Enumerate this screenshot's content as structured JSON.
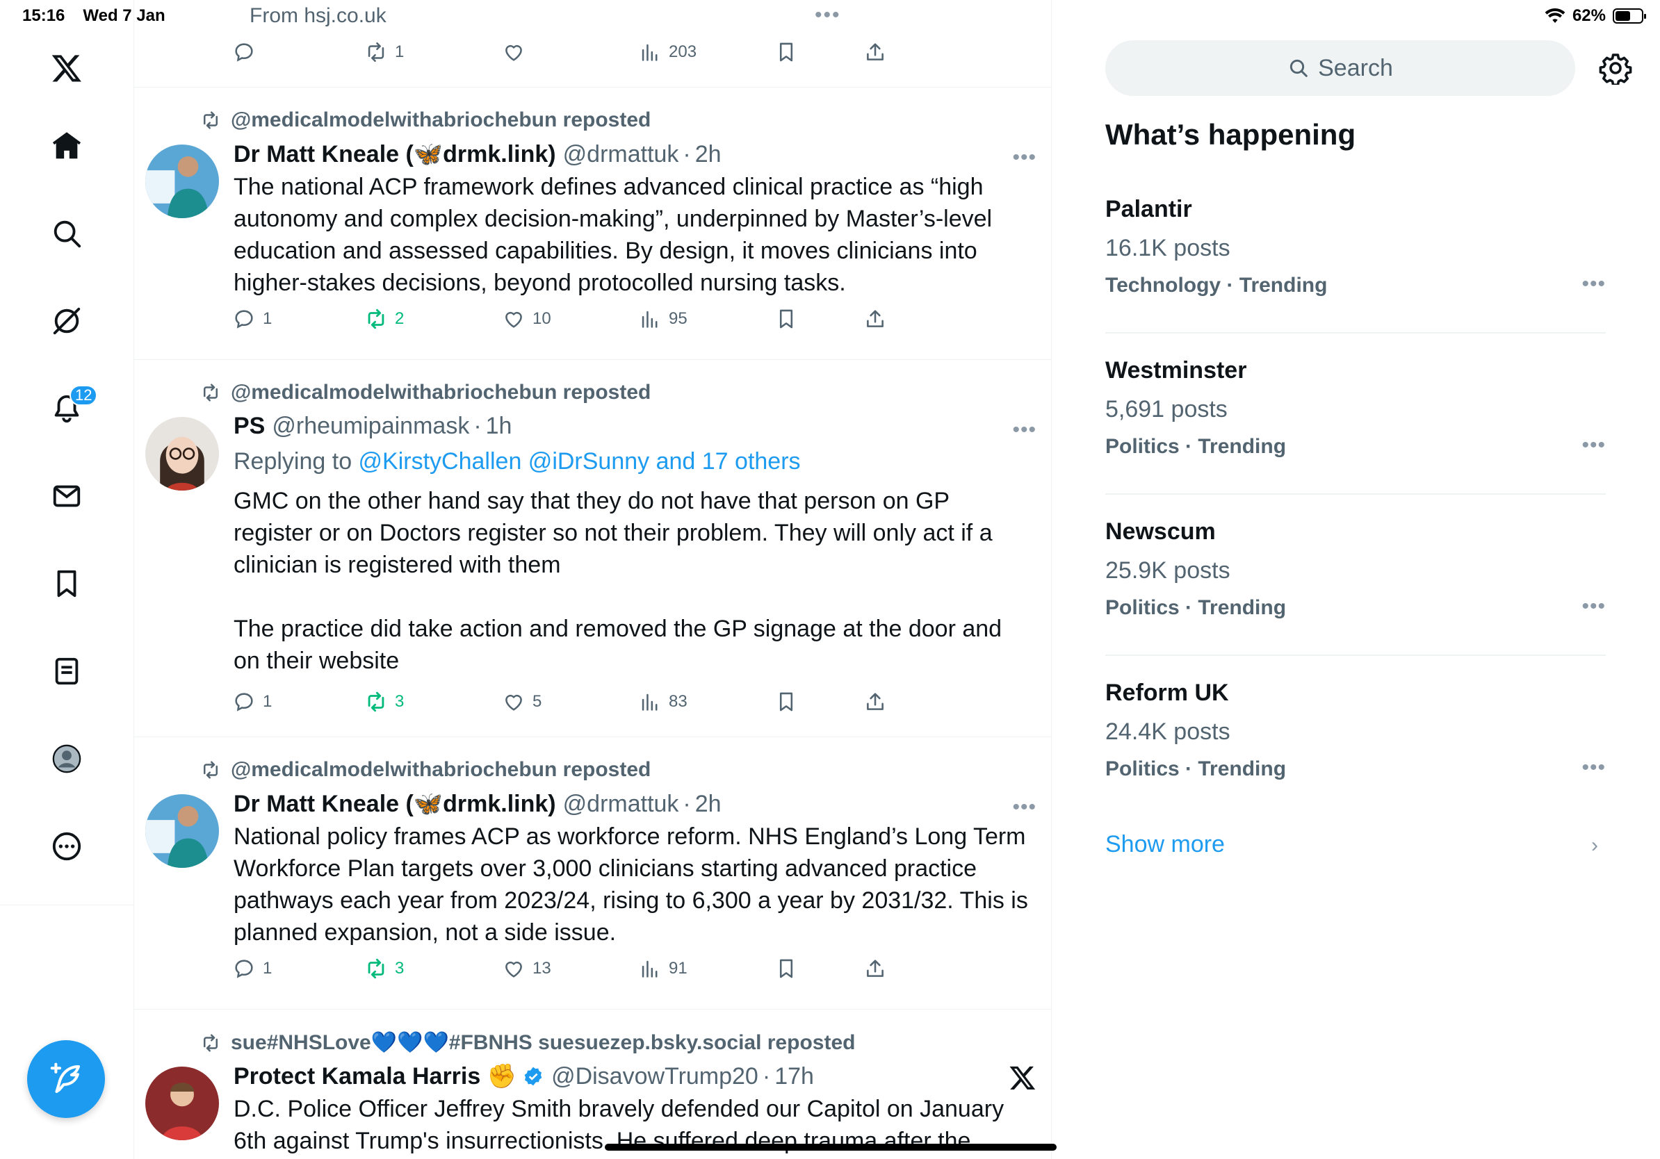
{
  "status_bar": {
    "time": "15:16",
    "date": "Wed 7 Jan",
    "battery": "62%",
    "battery_level": 0.62
  },
  "nav": {
    "items": [
      "x-logo",
      "home",
      "search",
      "grok",
      "notifications",
      "messages",
      "bookmarks",
      "lists",
      "profile",
      "more"
    ],
    "notification_count": "12"
  },
  "feed": {
    "source_line": "From hsj.co.uk",
    "top_stats": {
      "reposts": "1",
      "views": "203"
    },
    "tweets": [
      {
        "reposted_by": "@medicalmodelwithabriochebun reposted",
        "name": "Dr Matt Kneale (🦋drmk.link)",
        "handle": "@drmattuk",
        "time": "2h",
        "body": [
          "The national ACP framework defines advanced clinical practice as “high autonomy and complex decision-making”, underpinned by Master’s-level education and assessed capabilities. By design, it moves clinicians into higher-stakes decisions, beyond protocolled nursing tasks."
        ],
        "replies": "1",
        "reposts": "2",
        "likes": "10",
        "views": "95"
      },
      {
        "reposted_by": "@medicalmodelwithabriochebun reposted",
        "name": "PS",
        "handle": "@rheumipainmask",
        "time": "1h",
        "replying_prefix": "Replying to ",
        "replying_to": "@KirstyChallen @iDrSunny and 17 others",
        "body": [
          "GMC on the other hand say that they do not have that person on GP register or on Doctors register so not their problem. They will only act if a clinician is registered with them",
          "The practice did take action and removed the GP signage at the door and on their website"
        ],
        "replies": "1",
        "reposts": "3",
        "likes": "5",
        "views": "83"
      },
      {
        "reposted_by": "@medicalmodelwithabriochebun reposted",
        "name": "Dr Matt Kneale (🦋drmk.link)",
        "handle": "@drmattuk",
        "time": "2h",
        "body": [
          "National policy frames ACP as workforce reform. NHS England’s Long Term Workforce Plan targets over 3,000 clinicians starting advanced practice pathways each year from 2023/24, rising to 6,300 a year by 2031/32. This is planned expansion, not a side issue."
        ],
        "replies": "1",
        "reposts": "3",
        "likes": "13",
        "views": "91"
      },
      {
        "reposted_by": "sue#NHSLove💙💙💙#FBNHS suesuezep.bsky.social reposted",
        "name": "Protect Kamala Harris ✊",
        "handle": "@DisavowTrump20",
        "time": "17h",
        "body": [
          "D.C. Police Officer Jeffrey Smith bravely defended our Capitol on January 6th against Trump's insurrectionists. He suffered deep trauma after the"
        ]
      }
    ]
  },
  "sidebar": {
    "search_placeholder": "Search",
    "whats_happening": "What’s happening",
    "trends": [
      {
        "name": "Palantir",
        "count": "16.1K posts",
        "category": "Technology · Trending"
      },
      {
        "name": "Westminster",
        "count": "5,691 posts",
        "category": "Politics · Trending"
      },
      {
        "name": "Newscum",
        "count": "25.9K posts",
        "category": "Politics · Trending"
      },
      {
        "name": "Reform UK",
        "count": "24.4K posts",
        "category": "Politics · Trending"
      }
    ],
    "show_more": "Show more"
  },
  "colors": {
    "accent": "#1d9bf0",
    "muted": "#536471",
    "repost_green": "#00ba7c",
    "divider": "#eff3f4"
  }
}
